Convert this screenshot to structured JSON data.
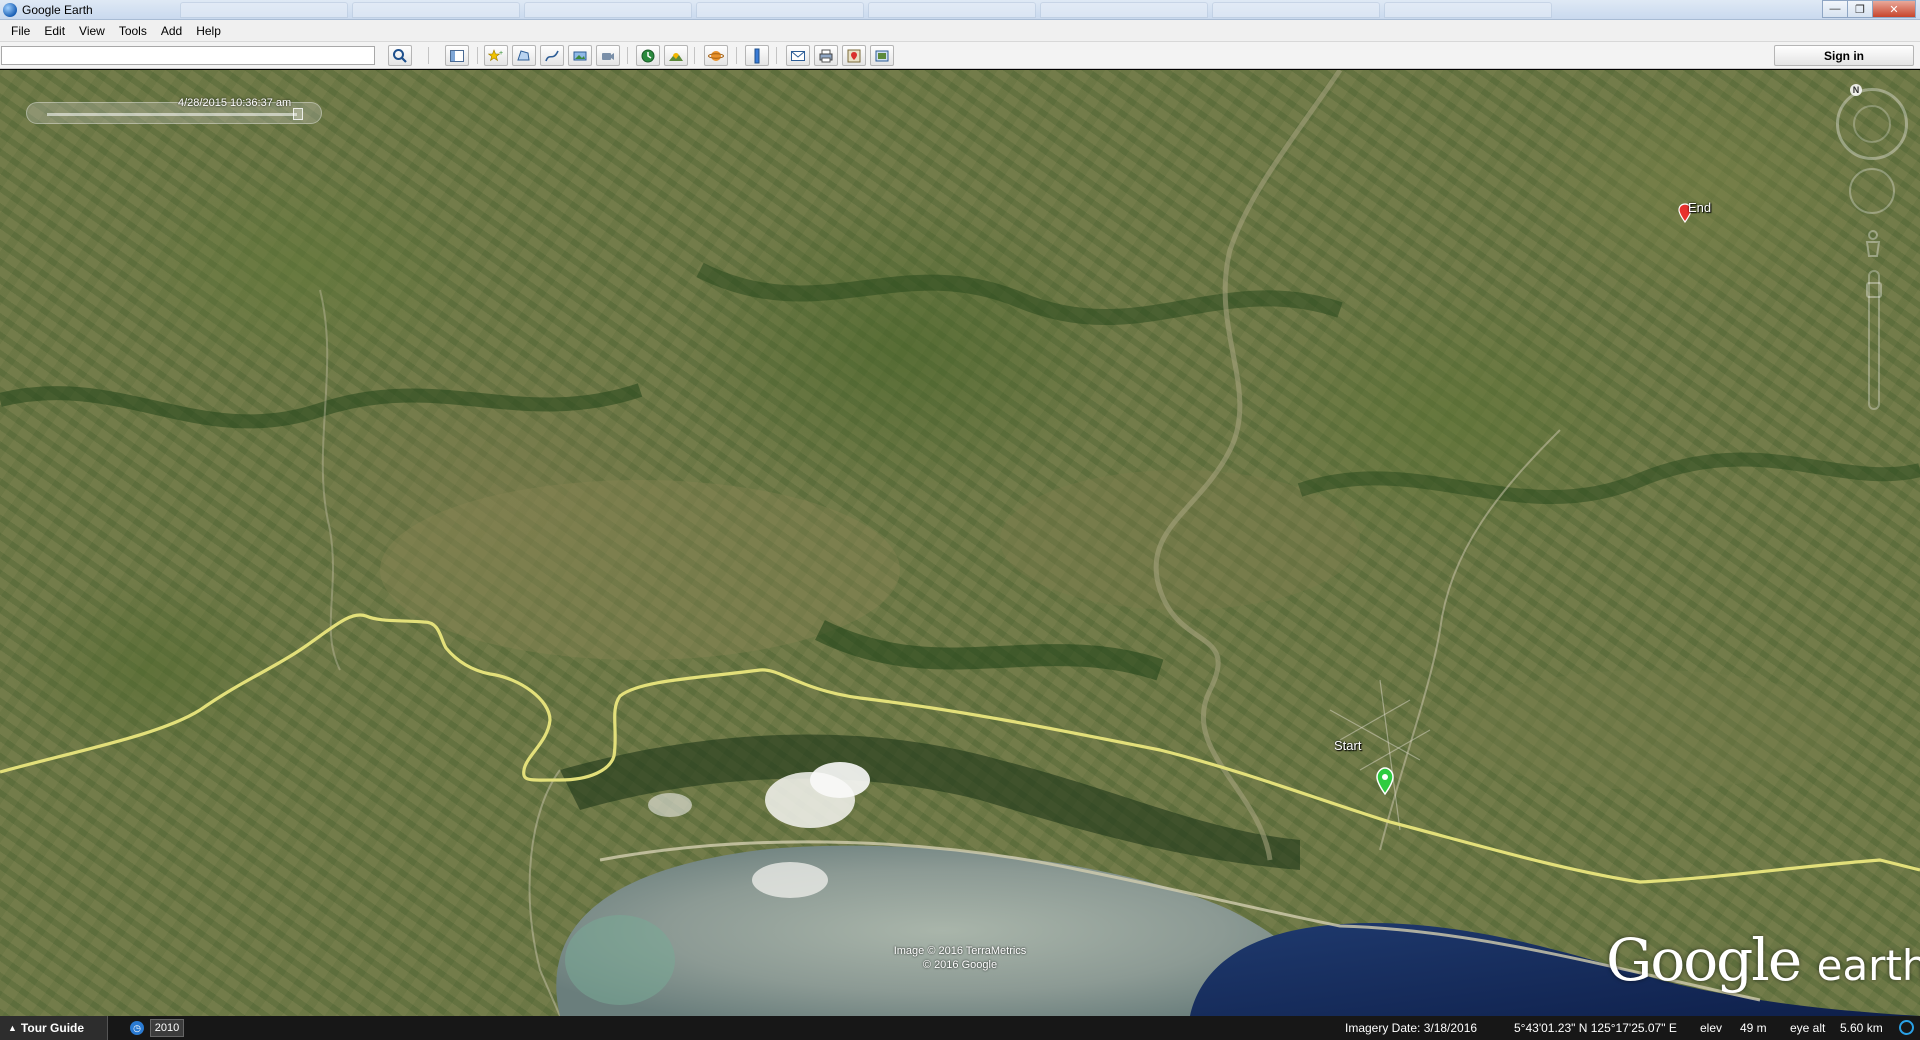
{
  "window": {
    "title": "Google Earth"
  },
  "menu": {
    "items": [
      {
        "label": "File"
      },
      {
        "label": "Edit"
      },
      {
        "label": "View"
      },
      {
        "label": "Tools"
      },
      {
        "label": "Add"
      },
      {
        "label": "Help"
      }
    ]
  },
  "toolbar": {
    "search_value": "",
    "signin_label": "Sign in"
  },
  "map": {
    "timestamp": "4/28/2015  10:36:37 am",
    "placemarks": {
      "start_label": "Start",
      "end_label": "End"
    },
    "copyright_line1": "Image © 2016 TerraMetrics",
    "copyright_line2": "© 2016 Google",
    "logo_main": "Google",
    "logo_sub": "earth",
    "path_color": "#e3e07a",
    "start_pin_color": "#2ecc40",
    "end_pin_color": "#e8302c"
  },
  "status": {
    "tour_guide_label": "Tour Guide",
    "historical_year": "2010",
    "imagery_date": "Imagery Date: 3/18/2016",
    "coordinates": "5°43'01.23\" N  125°17'25.07\" E",
    "elev_label": "elev",
    "elev_value": "49 m",
    "eye_alt_label": "eye alt",
    "eye_alt_value": "5.60 km"
  }
}
